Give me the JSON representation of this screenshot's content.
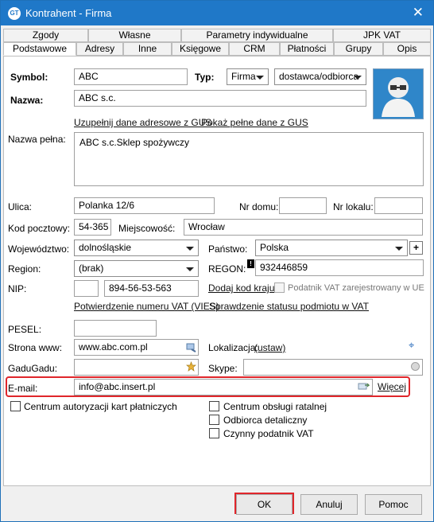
{
  "window": {
    "title": "Kontrahent - Firma",
    "app_icon": "GT"
  },
  "tabs": {
    "row1": [
      "Zgody",
      "Własne",
      "Parametry indywidualne",
      "JPK VAT"
    ],
    "row2": [
      "Podstawowe",
      "Adresy",
      "Inne",
      "Księgowe",
      "CRM",
      "Płatności",
      "Grupy",
      "Opis"
    ]
  },
  "form": {
    "symbol_label": "Symbol:",
    "symbol_value": "ABC",
    "type_label": "Typ:",
    "type_value": "Firma",
    "type_role": "dostawca/odbiorca",
    "name_label": "Nazwa:",
    "name_value": "ABC s.c.",
    "gus_link": "Uzupełnij dane adresowe z GUS",
    "full_gus_link": "Pokaż pełne dane z GUS",
    "full_name_label": "Nazwa pełna:",
    "full_name_value": "ABC s.c.Sklep spożywczy",
    "street_label": "Ulica:",
    "street_value": "Polanka  12/6",
    "house_label": "Nr domu:",
    "house_value": "",
    "local_label": "Nr lokalu:",
    "local_value": "",
    "postcode_label": "Kod pocztowy:",
    "postcode_value": "54-365",
    "city_label": "Miejscowość:",
    "city_value": "Wrocław",
    "province_label": "Województwo:",
    "province_value": "dolnośląskie",
    "country_label": "Państwo:",
    "country_value": "Polska",
    "country_add": "+",
    "region_label": "Region:",
    "region_value": "(brak)",
    "regon_label": "REGON:",
    "regon_value": "932446859",
    "regon_marker": "!",
    "nip_label": "NIP:",
    "nip_prefix": "",
    "nip_value": "894-56-53-563",
    "country_code_link": "Dodaj kod kraju",
    "vat_ue_label": "Podatnik VAT zarejestrowany w UE",
    "vat_confirm_link": "Potwierdzenie numeru VAT (VIES)",
    "vat_status_link": "Sprawdzenie statusu podmiotu w VAT",
    "pesel_label": "PESEL:",
    "pesel_value": "",
    "website_label": "Strona www:",
    "website_value": "www.abc.com.pl",
    "location_label": "Lokalizacja:",
    "location_link": "(ustaw)",
    "gadu_label": "GaduGadu:",
    "gadu_value": "",
    "skype_label": "Skype:",
    "skype_value": "",
    "email_label": "E-mail:",
    "email_value": "info@abc.insert.pl",
    "more_link": "Więcej",
    "card_center": "Centrum autoryzacji kart płatniczych",
    "installment_center": "Centrum obsługi ratalnej",
    "retail_receiver": "Odbiorca detaliczny",
    "active_vat": "Czynny podatnik VAT"
  },
  "buttons": {
    "ok": "OK",
    "cancel": "Anuluj",
    "help": "Pomoc"
  },
  "colors": {
    "titlebar": "#1f78c8",
    "highlight": "#e0262b"
  }
}
